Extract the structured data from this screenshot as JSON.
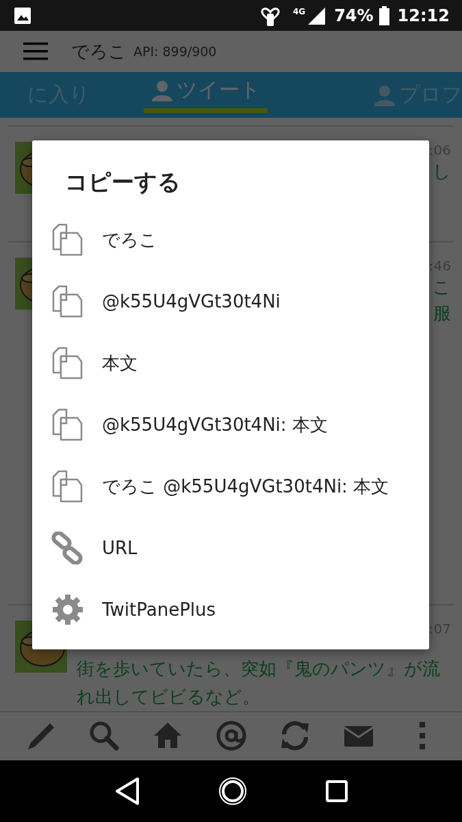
{
  "status_bar": {
    "network": "4G",
    "battery": "74%",
    "time": "12:12"
  },
  "app_bar": {
    "title": "でろこ",
    "api": "API: 899/900"
  },
  "tabs": [
    {
      "label": "に入り",
      "icon": false,
      "selected": false
    },
    {
      "label": "ツイート",
      "icon": true,
      "selected": true
    },
    {
      "label": "プロフ",
      "icon": true,
      "selected": false
    }
  ],
  "timeline": [
    {
      "time": ":06",
      "fragments": [
        "し"
      ]
    },
    {
      "time": ":46",
      "fragments": [
        "こ",
        "服"
      ]
    },
    {
      "time": ":07",
      "text": "街を歩いていたら、突如『鬼のパンツ』が流れ出してビビるなど。"
    }
  ],
  "dialog": {
    "title": "コピーする",
    "items": [
      {
        "kind": "copy",
        "label": "でろこ"
      },
      {
        "kind": "copy",
        "label": "@k55U4gVGt30t4Ni"
      },
      {
        "kind": "copy",
        "label": "本文"
      },
      {
        "kind": "copy",
        "label": "@k55U4gVGt30t4Ni: 本文"
      },
      {
        "kind": "copy",
        "label": "でろこ @k55U4gVGt30t4Ni: 本文"
      },
      {
        "kind": "link",
        "label": "URL"
      },
      {
        "kind": "settings",
        "label": "TwitPanePlus"
      }
    ]
  }
}
